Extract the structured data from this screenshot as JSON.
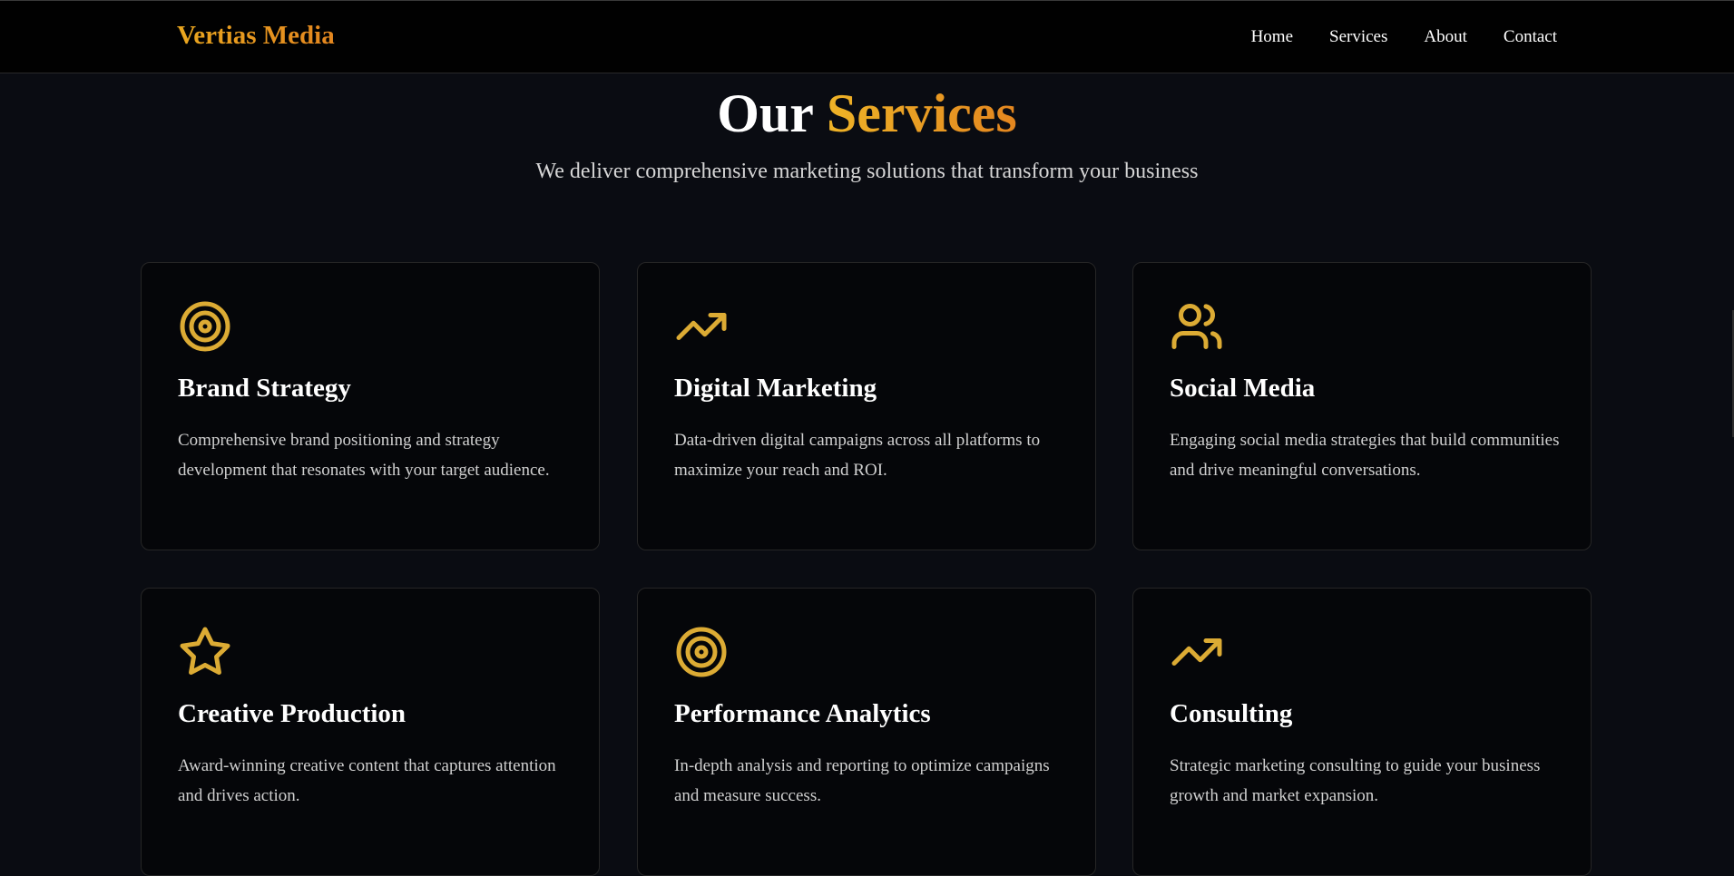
{
  "header": {
    "brand": "Vertias Media",
    "nav": [
      "Home",
      "Services",
      "About",
      "Contact"
    ]
  },
  "hero": {
    "title_main": "Our",
    "title_accent": "Services",
    "subtitle": "We deliver comprehensive marketing solutions that transform your business"
  },
  "colors": {
    "accent": "#e8a02a",
    "icon": "#dcab34",
    "background": "#0a0c12",
    "card": "#050609",
    "nav_bg": "#010101"
  },
  "services": [
    {
      "icon": "target-icon",
      "title": "Brand Strategy",
      "description": "Comprehensive brand positioning and strategy development that resonates with your target audience."
    },
    {
      "icon": "trending-up-icon",
      "title": "Digital Marketing",
      "description": "Data-driven digital campaigns across all platforms to maximize your reach and ROI."
    },
    {
      "icon": "users-icon",
      "title": "Social Media",
      "description": "Engaging social media strategies that build communities and drive meaningful conversations."
    },
    {
      "icon": "star-icon",
      "title": "Creative Production",
      "description": "Award-winning creative content that captures attention and drives action."
    },
    {
      "icon": "target-icon",
      "title": "Performance Analytics",
      "description": "In-depth analysis and reporting to optimize campaigns and measure success."
    },
    {
      "icon": "trending-up-icon",
      "title": "Consulting",
      "description": "Strategic marketing consulting to guide your business growth and market expansion."
    }
  ]
}
